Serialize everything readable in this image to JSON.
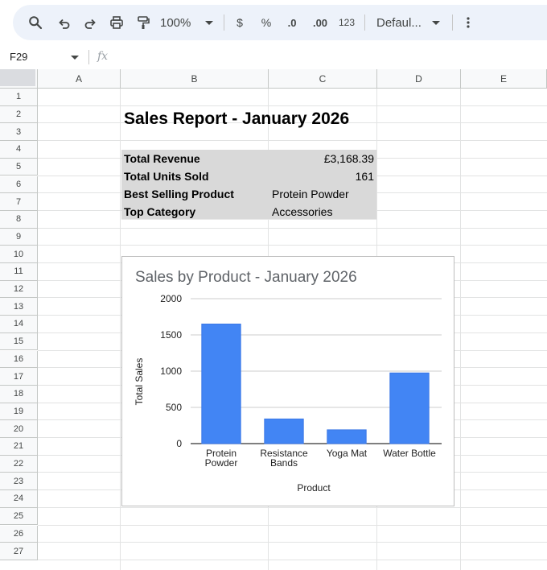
{
  "toolbar": {
    "zoom": "100%",
    "currency_symbol": "$",
    "percent_symbol": "%",
    "decrease_decimal": ".0",
    "increase_decimal": ".00",
    "number_format": "123",
    "font": "Defaul...",
    "icons": [
      "search-icon",
      "undo-icon",
      "redo-icon",
      "print-icon",
      "paint-format-icon",
      "more-vert-icon"
    ]
  },
  "formula_bar": {
    "cell_ref": "F29",
    "fx_label": "fx"
  },
  "columns": [
    "A",
    "B",
    "C",
    "D",
    "E"
  ],
  "rows": [
    "1",
    "2",
    "3",
    "4",
    "5",
    "6",
    "7",
    "8",
    "9",
    "10",
    "11",
    "12",
    "13",
    "14",
    "15",
    "16",
    "17",
    "18",
    "19",
    "20",
    "21",
    "22",
    "23",
    "24",
    "25",
    "26",
    "27"
  ],
  "sheet": {
    "title": "Sales Report - January 2026",
    "summary": [
      {
        "label": "Total Revenue",
        "value": "£3,168.39"
      },
      {
        "label": "Total Units Sold",
        "value": "161"
      },
      {
        "label": "Best Selling Product",
        "value": "Protein Powder"
      },
      {
        "label": "Top Category",
        "value": "Accessories"
      }
    ],
    "shade_color": "#d9d9d9"
  },
  "chart_data": {
    "type": "bar",
    "title": "Sales by Product - January 2026",
    "xlabel": "Product",
    "ylabel": "Total Sales",
    "categories": [
      [
        "Protein",
        "Powder"
      ],
      [
        "Resistance",
        "Bands"
      ],
      [
        "Yoga Mat"
      ],
      [
        "Water Bottle"
      ]
    ],
    "values": [
      1650,
      340,
      190,
      975
    ],
    "ylim": [
      0,
      2000
    ],
    "yticks": [
      "0",
      "500",
      "1000",
      "1500",
      "2000"
    ],
    "grid": true,
    "bar_color": "#4285f4"
  }
}
